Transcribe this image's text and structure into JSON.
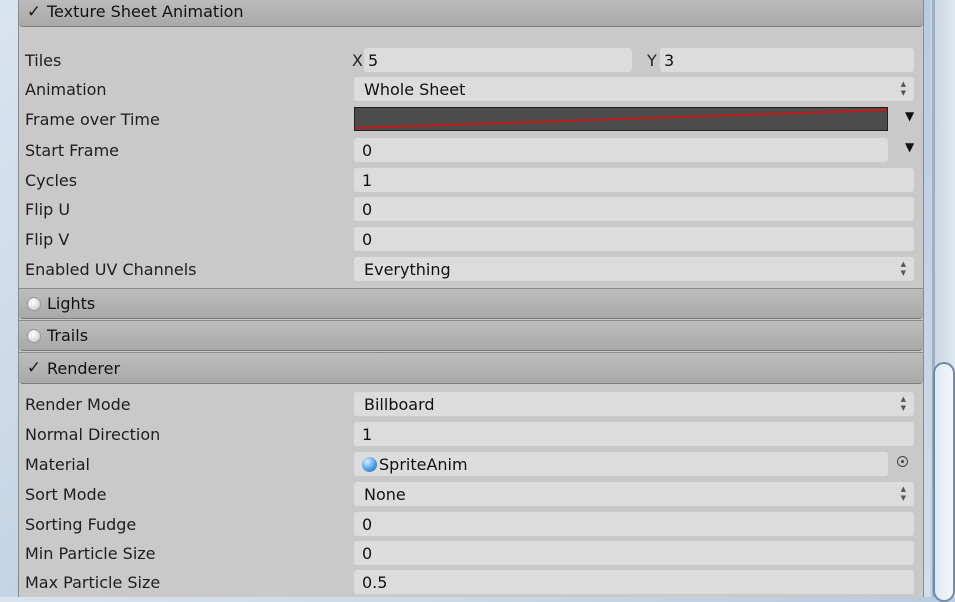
{
  "sections": {
    "texture_sheet": {
      "title": "Texture Sheet Animation",
      "enabled_icon": "check-icon",
      "rows": {
        "tiles": {
          "label": "Tiles",
          "x_label": "X",
          "x_value": "5",
          "y_label": "Y",
          "y_value": "3"
        },
        "animation": {
          "label": "Animation",
          "value": "Whole Sheet"
        },
        "frame_over_time": {
          "label": "Frame over Time",
          "curve_color": "#c41a1a"
        },
        "start_frame": {
          "label": "Start Frame",
          "value": "0"
        },
        "cycles": {
          "label": "Cycles",
          "value": "1"
        },
        "flip_u": {
          "label": "Flip U",
          "value": "0"
        },
        "flip_v": {
          "label": "Flip V",
          "value": "0"
        },
        "uv_channels": {
          "label": "Enabled UV Channels",
          "value": "Everything"
        }
      }
    },
    "lights": {
      "title": "Lights"
    },
    "trails": {
      "title": "Trails"
    },
    "renderer": {
      "title": "Renderer",
      "rows": {
        "render_mode": {
          "label": "Render Mode",
          "value": "Billboard"
        },
        "normal_direction": {
          "label": "Normal Direction",
          "value": "1"
        },
        "material": {
          "label": "Material",
          "value": "SpriteAnim"
        },
        "sort_mode": {
          "label": "Sort Mode",
          "value": "None"
        },
        "sorting_fudge": {
          "label": "Sorting Fudge",
          "value": "0"
        },
        "min_particle_size": {
          "label": "Min Particle Size",
          "value": "0"
        },
        "max_particle_size": {
          "label": "Max Particle Size",
          "value": "0.5"
        }
      }
    }
  },
  "glyphs": {
    "check": "✓",
    "updown_up": "▲",
    "updown_down": "▼",
    "dropdown": "▼"
  }
}
